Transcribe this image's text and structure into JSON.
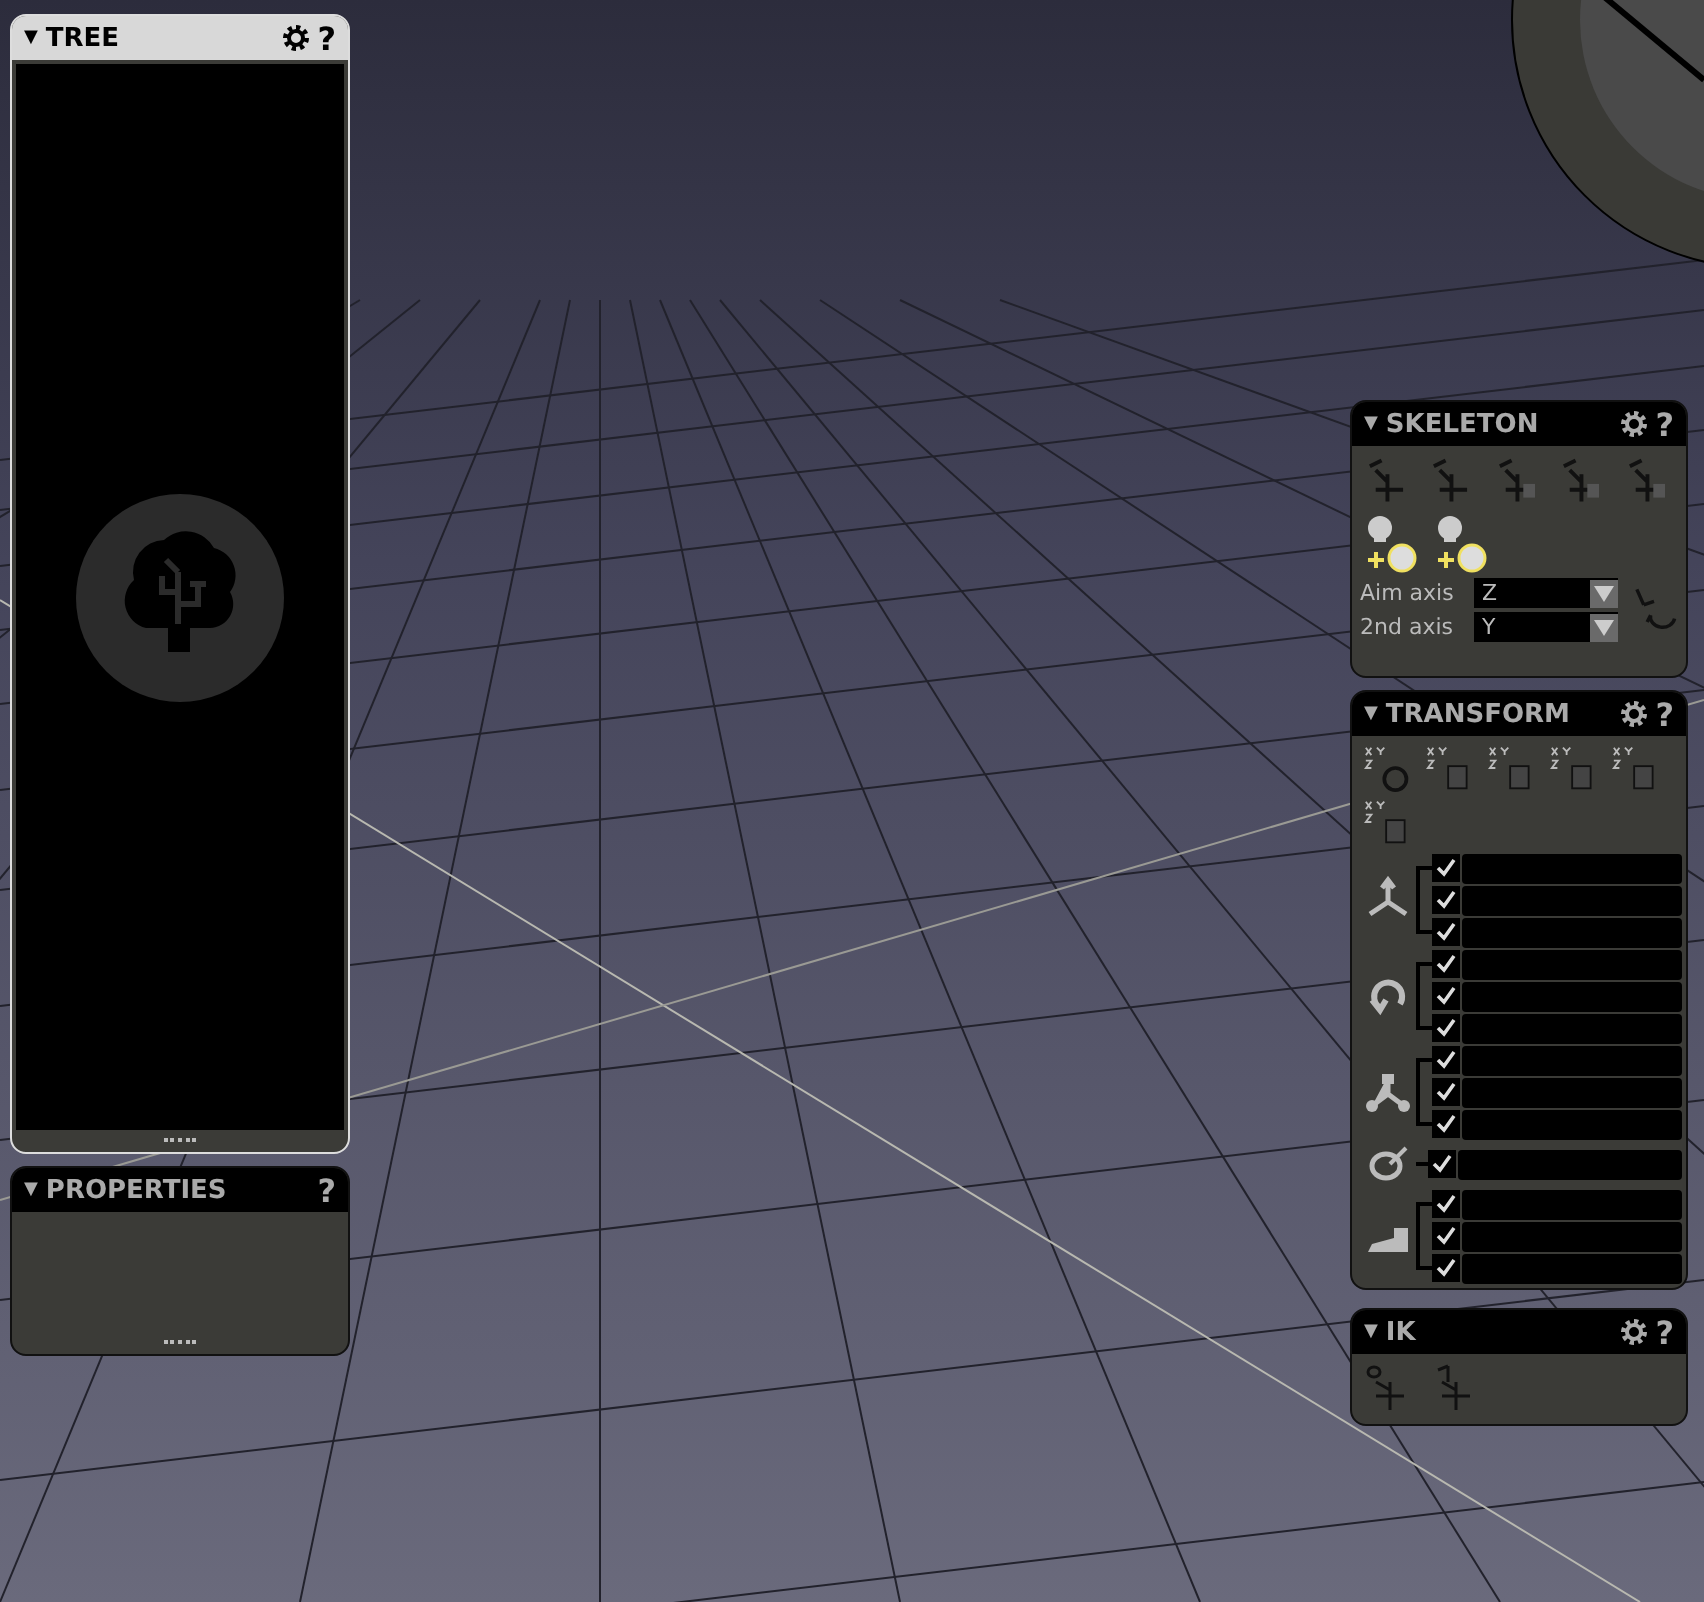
{
  "panels": [
    {
      "kind": "tree",
      "title": "TREE",
      "selected": true,
      "toggle": "▼",
      "settings": true,
      "help": "?"
    },
    {
      "kind": "properties",
      "title": "PROPERTIES",
      "selected": false,
      "toggle": "▼",
      "settings": false,
      "help": "?"
    },
    {
      "kind": "skeleton",
      "title": "SKELETON",
      "selected": false,
      "toggle": "▼",
      "settings": true,
      "help": "?",
      "fields": [
        {
          "label": "Aim axis",
          "value": "Z"
        },
        {
          "label": "2nd axis",
          "value": "Y"
        }
      ]
    },
    {
      "kind": "transform",
      "title": "TRANSFORM",
      "selected": false,
      "toggle": "▼",
      "settings": true,
      "help": "?",
      "groups": [
        {
          "kind": "translate",
          "checks": [
            {
              "checked": true
            },
            {
              "checked": true
            },
            {
              "checked": true
            }
          ]
        },
        {
          "kind": "rotate",
          "checks": [
            {
              "checked": true
            },
            {
              "checked": true
            },
            {
              "checked": true
            }
          ]
        },
        {
          "kind": "scale",
          "checks": [
            {
              "checked": true
            },
            {
              "checked": true
            },
            {
              "checked": true
            }
          ]
        },
        {
          "kind": "visibility",
          "checks": [
            {
              "checked": true
            }
          ]
        },
        {
          "kind": "foot",
          "checks": [
            {
              "checked": true
            },
            {
              "checked": true
            },
            {
              "checked": true
            }
          ]
        }
      ]
    },
    {
      "kind": "ik",
      "title": "IK",
      "selected": false,
      "toggle": "▼",
      "settings": true,
      "help": "?"
    }
  ]
}
